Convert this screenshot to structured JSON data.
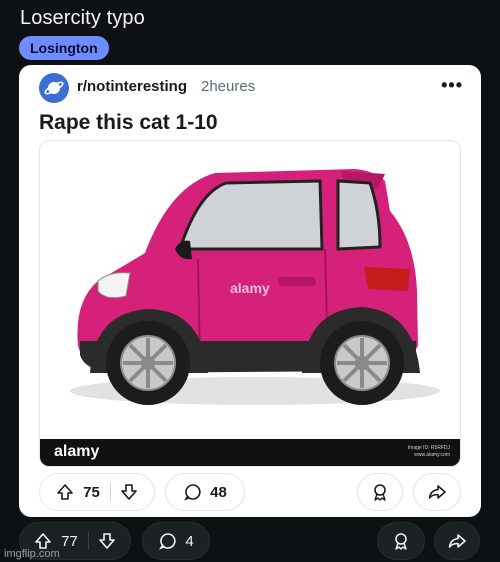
{
  "post": {
    "title": "Losercity typo",
    "flair": "Losington"
  },
  "card": {
    "subreddit": "r/notinteresting",
    "time": "2heures",
    "title": "Rape this cat 1-10",
    "image": {
      "alt_logo": "alamy",
      "watermark_center": "alamy",
      "image_id": "Image ID: R5RFDJ",
      "image_url": "www.alamy.com"
    },
    "votes": "75",
    "comments": "48"
  },
  "outer": {
    "votes": "77",
    "comments": "4"
  },
  "watermark": "imgflip.com",
  "colors": {
    "background": "#0e1113",
    "flair": "#6f8cff",
    "car_body": "#d6217a"
  }
}
